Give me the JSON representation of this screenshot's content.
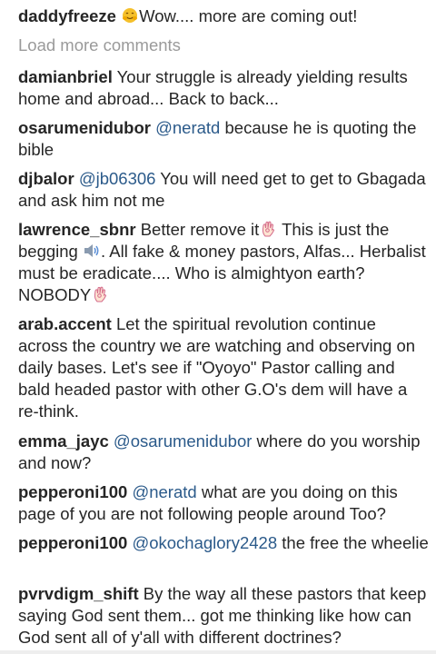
{
  "load_more": "Load more comments",
  "comments": [
    {
      "user": "daddyfreeze",
      "parts": [
        "",
        "Wow.... more are coming out!"
      ]
    },
    {
      "user": "damianbriel",
      "text": "Your struggle is already yielding results home and abroad... Back to back..."
    },
    {
      "user": "osarumenidubor",
      "mention": "@neratd",
      "text": "because he is quoting the bible"
    },
    {
      "user": "djbalor",
      "mention": "@jb06306",
      "text": "You will need get to get to Gbagada and ask him not me"
    },
    {
      "user": "lawrence_sbnr",
      "parts": [
        "Better remove it",
        "This is just the begging",
        ". All fake & money pastors, Alfas... Herbalist must be eradicate.... Who is almightyon earth? NOBODY"
      ]
    },
    {
      "user": "arab.accent",
      "text": "Let the spiritual revolution continue across the country we are watching and observing on daily bases. Let's see if \"Oyoyo\" Pastor calling and bald headed pastor with other G.O's dem will have a re-think."
    },
    {
      "user": "emma_jayc",
      "mention": "@osarumenidubor",
      "text": "where do you worship and now?"
    },
    {
      "user": "pepperoni100",
      "mention": "@neratd",
      "text": "what are you doing on this page of you are not following people around Too?"
    },
    {
      "user": "pepperoni100",
      "mention": "@okochaglory2428",
      "text": "the free the wheelie"
    },
    {
      "user": "pvrvdigm_shift",
      "text": "By the way all these pastors that keep saying God sent them... got me thinking like how can God sent all of y'all with different doctrines?"
    }
  ],
  "icons": {
    "hug": "hugging-face-icon",
    "ok_hand": "ok-hand-icon",
    "speaker": "speaker-icon"
  },
  "colors": {
    "text": "#262626",
    "mention": "#2b5a8a",
    "muted": "#9a9a9a"
  }
}
